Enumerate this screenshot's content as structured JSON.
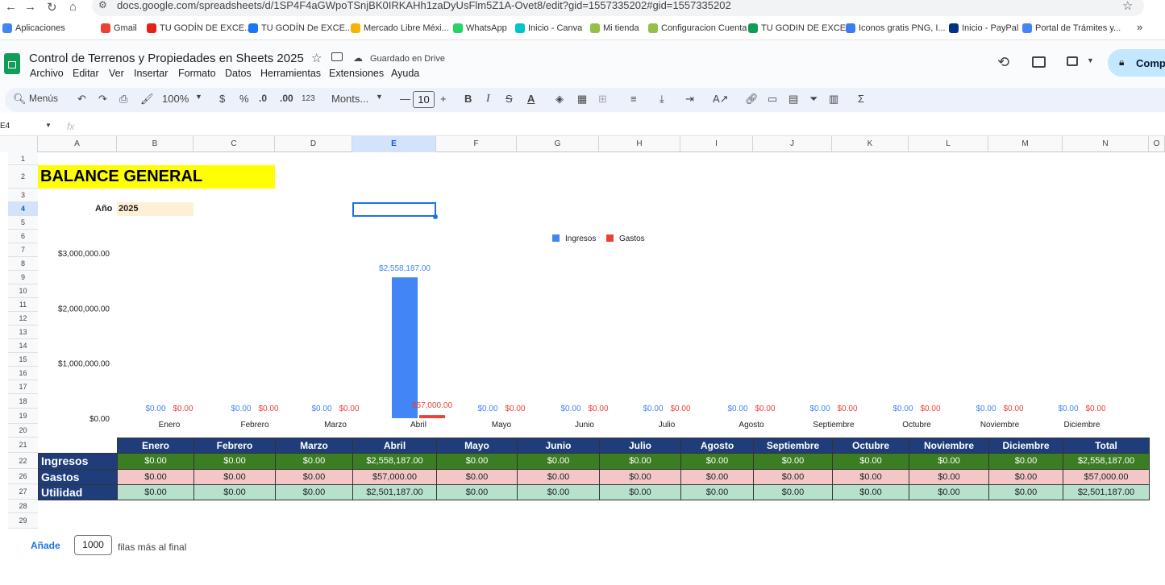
{
  "browser": {
    "url": "docs.google.com/spreadsheets/d/1SP4F4aGWpoTSnjBK0IRKAHh1zaDyUsFlm5Z1A-Ovet8/edit?gid=1557335202#gid=1557335202",
    "bookmarks": [
      "Aplicaciones",
      "Gmail",
      "TU GODÍN DE EXCE...",
      "TU GODÍN De EXCE...",
      "Mercado Libre Méxi...",
      "WhatsApp",
      "Inicio - Canva",
      "Mi tienda",
      "Configuracion Cuenta",
      "TU GODIN DE EXCEL",
      "Iconos gratis PNG, I...",
      "Inicio - PayPal",
      "Portal de Trámites y..."
    ]
  },
  "sheets": {
    "title": "Control de Terrenos y Propiedades en Sheets 2025",
    "saved_status": "Guardado en Drive",
    "share_label": "Compa",
    "menus": [
      "Archivo",
      "Editar",
      "Ver",
      "Insertar",
      "Formato",
      "Datos",
      "Herramientas",
      "Extensiones",
      "Ayuda"
    ],
    "toolbar": {
      "search": "Menús",
      "zoom": "100%",
      "currency": "$",
      "percent": "%",
      "dec_less": ".0",
      "dec_more": ".00",
      "number_fmt": "123",
      "font": "Monts...",
      "font_size": "10"
    },
    "name_box": "E4",
    "fx": "fx",
    "columns": [
      "A",
      "B",
      "C",
      "D",
      "E",
      "F",
      "G",
      "H",
      "I",
      "J",
      "K",
      "L",
      "M",
      "N",
      "O"
    ],
    "rows": [
      "1",
      "2",
      "3",
      "4",
      "5",
      "6",
      "7",
      "8",
      "9",
      "10",
      "11",
      "12",
      "13",
      "14",
      "15",
      "16",
      "17",
      "18",
      "19",
      "20",
      "21",
      "22",
      "26",
      "27",
      "28",
      "29"
    ],
    "heading": "BALANCE GENERAL",
    "year_label": "Año",
    "year_value": "2025",
    "add_rows": {
      "button": "Añade",
      "count": "1000",
      "suffix": "filas más al final"
    }
  },
  "chart_data": {
    "type": "bar",
    "categories": [
      "Enero",
      "Febrero",
      "Marzo",
      "Abril",
      "Mayo",
      "Junio",
      "Julio",
      "Agosto",
      "Septiembre",
      "Octubre",
      "Noviembre",
      "Diciembre"
    ],
    "series": [
      {
        "name": "Ingresos",
        "color": "#4285f4",
        "values": [
          0,
          0,
          0,
          2558187,
          0,
          0,
          0,
          0,
          0,
          0,
          0,
          0
        ]
      },
      {
        "name": "Gastos",
        "color": "#ea4335",
        "values": [
          0,
          0,
          0,
          57000,
          0,
          0,
          0,
          0,
          0,
          0,
          0,
          0
        ]
      }
    ],
    "ylim": [
      0,
      3000000
    ],
    "yticks": [
      "$0.00",
      "$1,000,000.00",
      "$2,000,000.00",
      "$3,000,000.00"
    ],
    "legend": "top-center",
    "grid": false
  },
  "table": {
    "header": [
      "Enero",
      "Febrero",
      "Marzo",
      "Abril",
      "Mayo",
      "Junio",
      "Julio",
      "Agosto",
      "Septiembre",
      "Octubre",
      "Noviembre",
      "Diciembre",
      "Total"
    ],
    "rows": [
      {
        "label": "Ingresos",
        "values": [
          "$0.00",
          "$0.00",
          "$0.00",
          "$2,558,187.00",
          "$0.00",
          "$0.00",
          "$0.00",
          "$0.00",
          "$0.00",
          "$0.00",
          "$0.00",
          "$0.00",
          "$2,558,187.00"
        ],
        "color": "#3a7d22",
        "text": "#ffffff"
      },
      {
        "label": "Gastos",
        "values": [
          "$0.00",
          "$0.00",
          "$0.00",
          "$57,000.00",
          "$0.00",
          "$0.00",
          "$0.00",
          "$0.00",
          "$0.00",
          "$0.00",
          "$0.00",
          "$0.00",
          "$57,000.00"
        ],
        "color": "#f4c7c7",
        "text": "#1f1f1f"
      },
      {
        "label": "Utilidad",
        "values": [
          "$0.00",
          "$0.00",
          "$0.00",
          "$2,501,187.00",
          "$0.00",
          "$0.00",
          "$0.00",
          "$0.00",
          "$0.00",
          "$0.00",
          "$0.00",
          "$0.00",
          "$2,501,187.00"
        ],
        "color": "#b7e1cd",
        "text": "#1f1f1f"
      }
    ],
    "header_color": "#1f3d7a",
    "label_color": "#1f3d7a"
  }
}
